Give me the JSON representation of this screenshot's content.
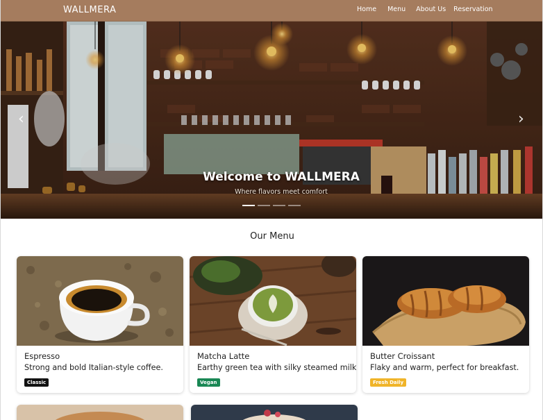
{
  "nav": {
    "brand": "WALLMERA",
    "links": [
      "Home",
      "Menu",
      "About Us",
      "Reservation"
    ]
  },
  "hero": {
    "title": "Welcome to WALLMERA",
    "subtitle": "Where flavors meet comfort",
    "prev_icon": "chevron-left-icon",
    "next_icon": "chevron-right-icon",
    "slide_count": 4,
    "active_slide": 1
  },
  "menu": {
    "title": "Our Menu",
    "items": [
      {
        "name": "Espresso",
        "desc": "Strong and bold Italian-style coffee.",
        "badge": "Classic",
        "badge_color": "#111111"
      },
      {
        "name": "Matcha Latte",
        "desc": "Earthy green tea with silky steamed milk.",
        "badge": "Vegan",
        "badge_color": "#198754"
      },
      {
        "name": "Butter Croissant",
        "desc": "Flaky and warm, perfect for breakfast.",
        "badge": "Fresh Daily",
        "badge_color": "#f0b429"
      }
    ]
  },
  "colors": {
    "nav_bg": "#a57c5e",
    "accent": "#a57c5e"
  }
}
